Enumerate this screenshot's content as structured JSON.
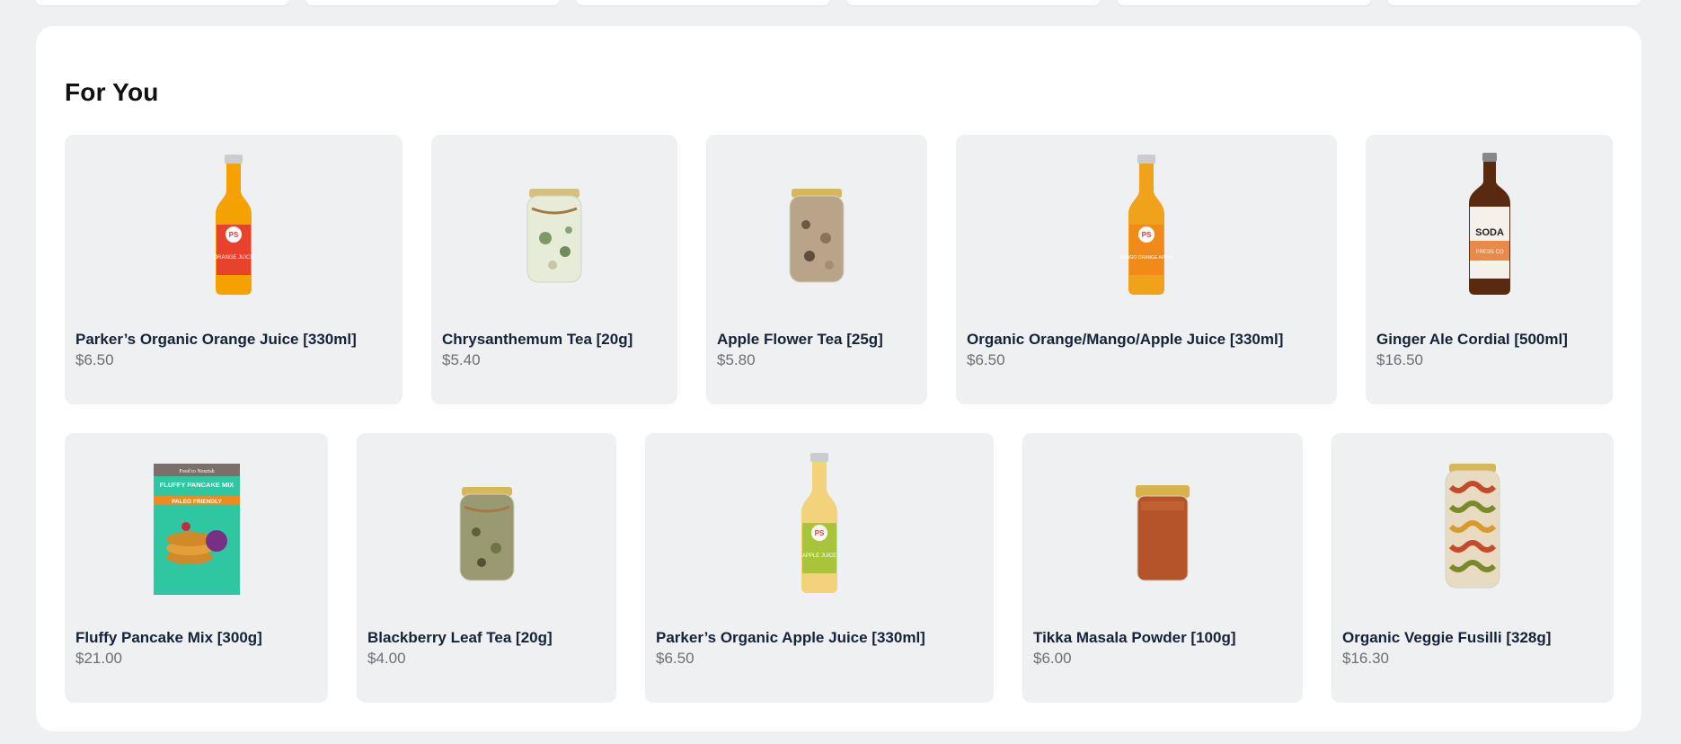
{
  "section": {
    "title": "For You"
  },
  "products": [
    {
      "name": "Parker’s Organic Orange Juice [330ml]",
      "price": "$6.50",
      "icon": "orange-juice-bottle-icon"
    },
    {
      "name": "Chrysanthemum Tea [20g]",
      "price": "$5.40",
      "icon": "tea-jar-icon"
    },
    {
      "name": "Apple Flower Tea [25g]",
      "price": "$5.80",
      "icon": "tea-jar-icon"
    },
    {
      "name": "Organic Orange/Mango/Apple Juice [330ml]",
      "price": "$6.50",
      "icon": "mango-juice-bottle-icon"
    },
    {
      "name": "Ginger Ale Cordial [500ml]",
      "price": "$16.50",
      "icon": "cordial-bottle-icon"
    },
    {
      "name": "Fluffy Pancake Mix [300g]",
      "price": "$21.00",
      "icon": "pancake-mix-box-icon"
    },
    {
      "name": "Blackberry Leaf Tea [20g]",
      "price": "$4.00",
      "icon": "tea-jar-icon"
    },
    {
      "name": "Parker’s Organic Apple Juice [330ml]",
      "price": "$6.50",
      "icon": "apple-juice-bottle-icon"
    },
    {
      "name": "Tikka Masala Powder [100g]",
      "price": "$6.00",
      "icon": "spice-jar-icon"
    },
    {
      "name": "Organic Veggie Fusilli [328g]",
      "price": "$16.30",
      "icon": "pasta-jar-icon"
    }
  ],
  "labels": {
    "ps_brand": "PS",
    "orange_juice_label": "ORANGE JUICE",
    "mango_juice_label": "MANGO ORANGE APPLE",
    "apple_juice_label": "APPLE JUICE",
    "soda_brand": "SODA",
    "soda_press": "PRESS CO",
    "pancake_brand": "Food to Nourish",
    "pancake_title": "FLUFFY PANCAKE MIX",
    "pancake_tag": "PALEO FRIENDLY"
  },
  "colors": {
    "card_bg": "#eef0f2",
    "name": "#152338",
    "price": "#6c6f74"
  }
}
